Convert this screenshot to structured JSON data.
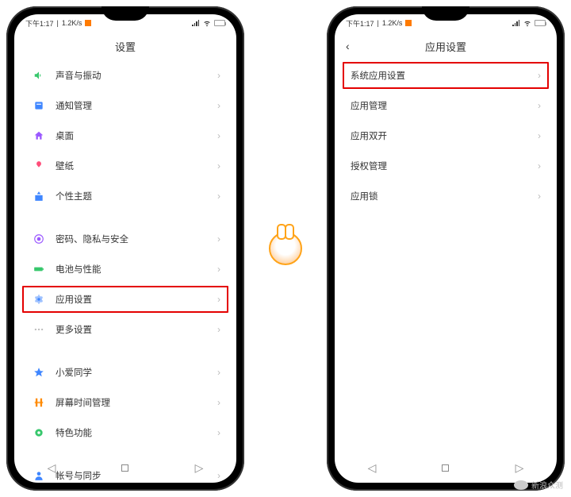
{
  "status": {
    "time": "下午1:17",
    "speed": "1.2K/s"
  },
  "left_phone": {
    "header_title": "设置",
    "groups": [
      [
        {
          "icon": "sound-icon",
          "color": "#37c76c",
          "label": "声音与振动"
        },
        {
          "icon": "notify-icon",
          "color": "#3f86ff",
          "label": "通知管理"
        },
        {
          "icon": "home-icon",
          "color": "#9b59ff",
          "label": "桌面"
        },
        {
          "icon": "wallpaper-icon",
          "color": "#ff4d7a",
          "label": "壁纸"
        },
        {
          "icon": "theme-icon",
          "color": "#3f86ff",
          "label": "个性主题"
        }
      ],
      [
        {
          "icon": "privacy-icon",
          "color": "#9b59ff",
          "label": "密码、隐私与安全"
        },
        {
          "icon": "battery-icon",
          "color": "#37c76c",
          "label": "电池与性能"
        },
        {
          "icon": "app-settings-icon",
          "color": "#3f86ff",
          "label": "应用设置",
          "highlight": true
        },
        {
          "icon": "more-icon",
          "color": "#bdbdbd",
          "label": "更多设置"
        }
      ],
      [
        {
          "icon": "ai-icon",
          "color": "#3f86ff",
          "label": "小爱同学"
        },
        {
          "icon": "screentime-icon",
          "color": "#ff8a00",
          "label": "屏幕时间管理"
        },
        {
          "icon": "features-icon",
          "color": "#37c76c",
          "label": "特色功能"
        }
      ],
      [
        {
          "icon": "account-icon",
          "color": "#3f86ff",
          "label": "帐号与同步"
        }
      ]
    ]
  },
  "right_phone": {
    "header_title": "应用设置",
    "items": [
      {
        "label": "系统应用设置",
        "highlight": true
      },
      {
        "label": "应用管理"
      },
      {
        "label": "应用双开"
      },
      {
        "label": "授权管理"
      },
      {
        "label": "应用锁"
      }
    ]
  },
  "watermark": {
    "mascot_text": "",
    "sina": "新浪众测"
  }
}
